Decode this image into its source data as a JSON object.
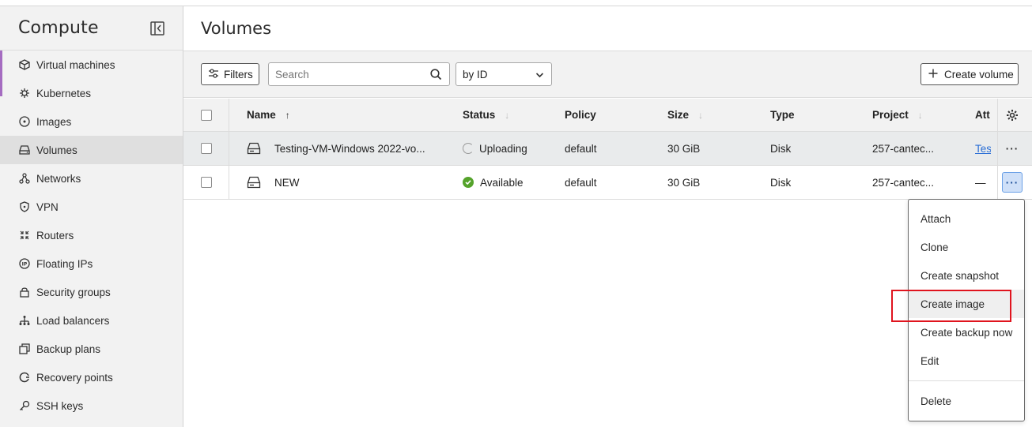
{
  "sidebar": {
    "title": "Compute",
    "items": [
      {
        "label": "Virtual machines",
        "icon": "cube-icon"
      },
      {
        "label": "Kubernetes",
        "icon": "kubernetes-icon"
      },
      {
        "label": "Images",
        "icon": "disc-icon"
      },
      {
        "label": "Volumes",
        "icon": "drive-icon",
        "active": true
      },
      {
        "label": "Networks",
        "icon": "network-icon"
      },
      {
        "label": "VPN",
        "icon": "shield-icon"
      },
      {
        "label": "Routers",
        "icon": "router-icon"
      },
      {
        "label": "Floating IPs",
        "icon": "ip-icon"
      },
      {
        "label": "Security groups",
        "icon": "lock-icon"
      },
      {
        "label": "Load balancers",
        "icon": "load-balancer-icon"
      },
      {
        "label": "Backup plans",
        "icon": "backup-icon"
      },
      {
        "label": "Recovery points",
        "icon": "recovery-icon"
      },
      {
        "label": "SSH keys",
        "icon": "key-icon"
      }
    ]
  },
  "page": {
    "title": "Volumes"
  },
  "toolbar": {
    "filters_label": "Filters",
    "search_placeholder": "Search",
    "sort_select": "by ID",
    "create_label": "Create volume"
  },
  "table": {
    "columns": [
      "Name",
      "Status",
      "Policy",
      "Size",
      "Type",
      "Project",
      "Att"
    ],
    "rows": [
      {
        "name": "Testing-VM-Windows 2022-vo...",
        "status": "Uploading",
        "policy": "default",
        "size": "30 GiB",
        "type": "Disk",
        "project": "257-cantec...",
        "attached": "Tes"
      },
      {
        "name": "NEW",
        "status": "Available",
        "policy": "default",
        "size": "30 GiB",
        "type": "Disk",
        "project": "257-cantec...",
        "attached": "—"
      }
    ]
  },
  "menu": {
    "items": [
      "Attach",
      "Clone",
      "Create snapshot",
      "Create image",
      "Create backup now",
      "Edit"
    ],
    "danger": "Delete"
  },
  "colors": {
    "accent": "#a56cc1",
    "highlight": "#e0141e",
    "link": "#2b6fd6",
    "available": "#55a32b"
  }
}
